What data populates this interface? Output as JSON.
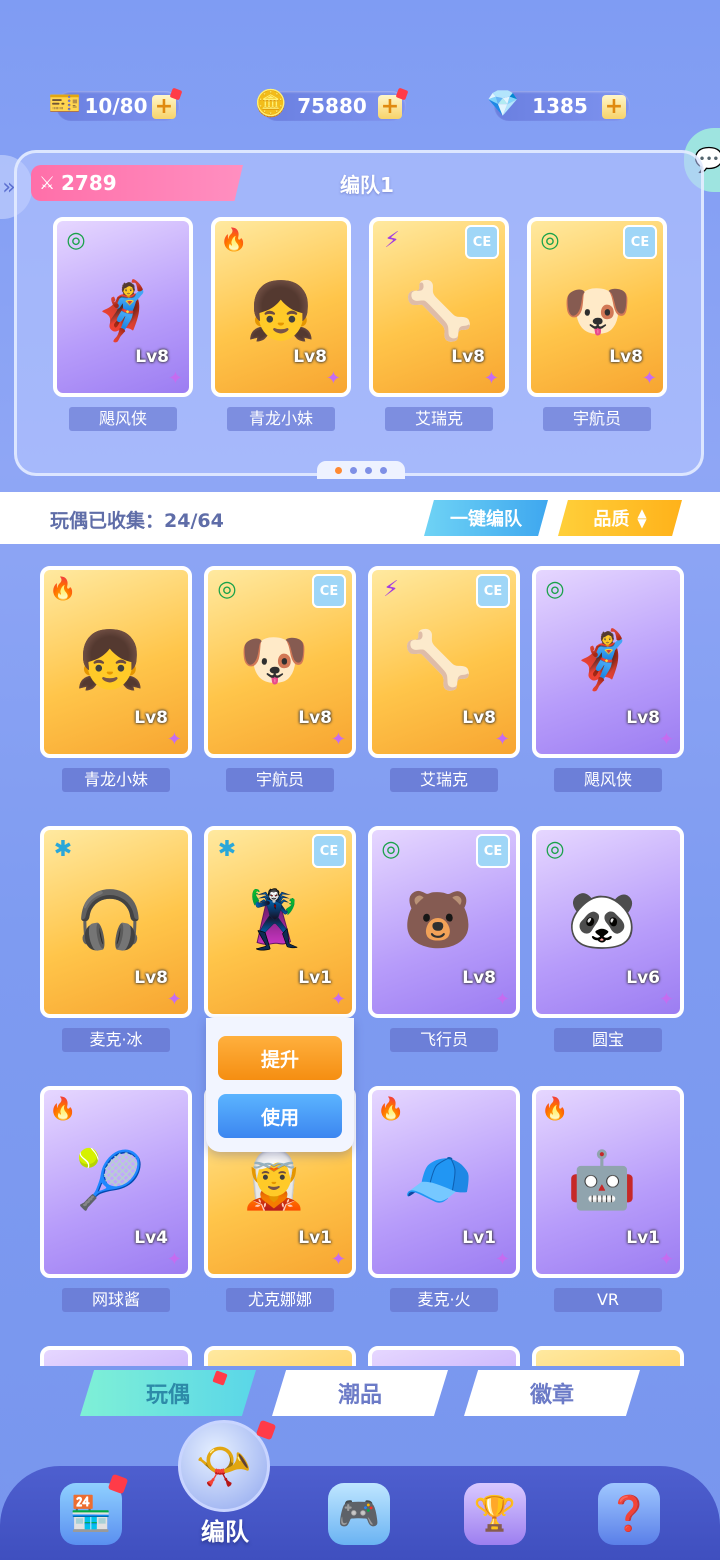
{
  "resources": {
    "tickets": {
      "value": "10/80",
      "icon": "ticket-icon"
    },
    "coins": {
      "value": "75880",
      "icon": "coin-icon"
    },
    "gems": {
      "value": "1385",
      "icon": "crystal-icon"
    }
  },
  "team": {
    "power": "2789",
    "title": "编队1",
    "members": [
      {
        "name": "飓风侠",
        "level": "Lv8",
        "element": "wind",
        "rarity": "purple",
        "ce": false,
        "emoji": "🦸"
      },
      {
        "name": "青龙小妹",
        "level": "Lv8",
        "element": "fire",
        "rarity": "orange",
        "ce": false,
        "emoji": "👧"
      },
      {
        "name": "艾瑞克",
        "level": "Lv8",
        "element": "bolt",
        "rarity": "orange",
        "ce": true,
        "emoji": "🦴"
      },
      {
        "name": "宇航员",
        "level": "Lv8",
        "element": "wind",
        "rarity": "orange",
        "ce": true,
        "emoji": "🐶"
      }
    ],
    "page_count": 4,
    "current_page": 1
  },
  "collection": {
    "label": "玩偶已收集：24/64",
    "auto_button": "一键编队",
    "quality_button": "品质"
  },
  "dolls": [
    {
      "name": "青龙小妹",
      "level": "Lv8",
      "element": "fire",
      "rarity": "orange",
      "ce": false,
      "emoji": "👧"
    },
    {
      "name": "宇航员",
      "level": "Lv8",
      "element": "wind",
      "rarity": "orange",
      "ce": true,
      "emoji": "🐶"
    },
    {
      "name": "艾瑞克",
      "level": "Lv8",
      "element": "bolt",
      "rarity": "orange",
      "ce": true,
      "emoji": "🦴"
    },
    {
      "name": "飓风侠",
      "level": "Lv8",
      "element": "wind",
      "rarity": "purple",
      "ce": false,
      "emoji": "🦸"
    },
    {
      "name": "麦克·冰",
      "level": "Lv8",
      "element": "ice",
      "rarity": "orange",
      "ce": false,
      "emoji": "🎧"
    },
    {
      "name": "",
      "level": "Lv1",
      "element": "ice",
      "rarity": "orange",
      "ce": true,
      "emoji": "🦹"
    },
    {
      "name": "飞行员",
      "level": "Lv8",
      "element": "wind",
      "rarity": "purple",
      "ce": true,
      "emoji": "🐻"
    },
    {
      "name": "圆宝",
      "level": "Lv6",
      "element": "wind",
      "rarity": "purple",
      "ce": false,
      "emoji": "🐼"
    },
    {
      "name": "网球酱",
      "level": "Lv4",
      "element": "fire",
      "rarity": "purple",
      "ce": false,
      "emoji": "🎾"
    },
    {
      "name": "尤克娜娜",
      "level": "Lv1",
      "element": "",
      "rarity": "orange",
      "ce": false,
      "emoji": "🧝"
    },
    {
      "name": "麦克·火",
      "level": "Lv1",
      "element": "fire",
      "rarity": "purple",
      "ce": false,
      "emoji": "🧢"
    },
    {
      "name": "VR",
      "level": "Lv1",
      "element": "fire",
      "rarity": "purple",
      "ce": false,
      "emoji": "🤖"
    }
  ],
  "popup": {
    "upgrade": "提升",
    "use": "使用"
  },
  "category_tabs": [
    "玩偶",
    "潮品",
    "徽章"
  ],
  "bottom_nav": {
    "active_label": "编队",
    "items": [
      "shop-icon",
      "team-whistle-icon",
      "gamepad-icon",
      "trophy-icon",
      "mystery-box-icon"
    ]
  },
  "element_symbols": {
    "wind": "◎",
    "fire": "🔥",
    "bolt": "⚡",
    "ice": "✱"
  },
  "colors": {
    "accent_pink": "#ff6fa9",
    "button_blue": "#3ea7ef",
    "button_yellow": "#ffb21a",
    "upgrade_orange": "#f58e12"
  }
}
